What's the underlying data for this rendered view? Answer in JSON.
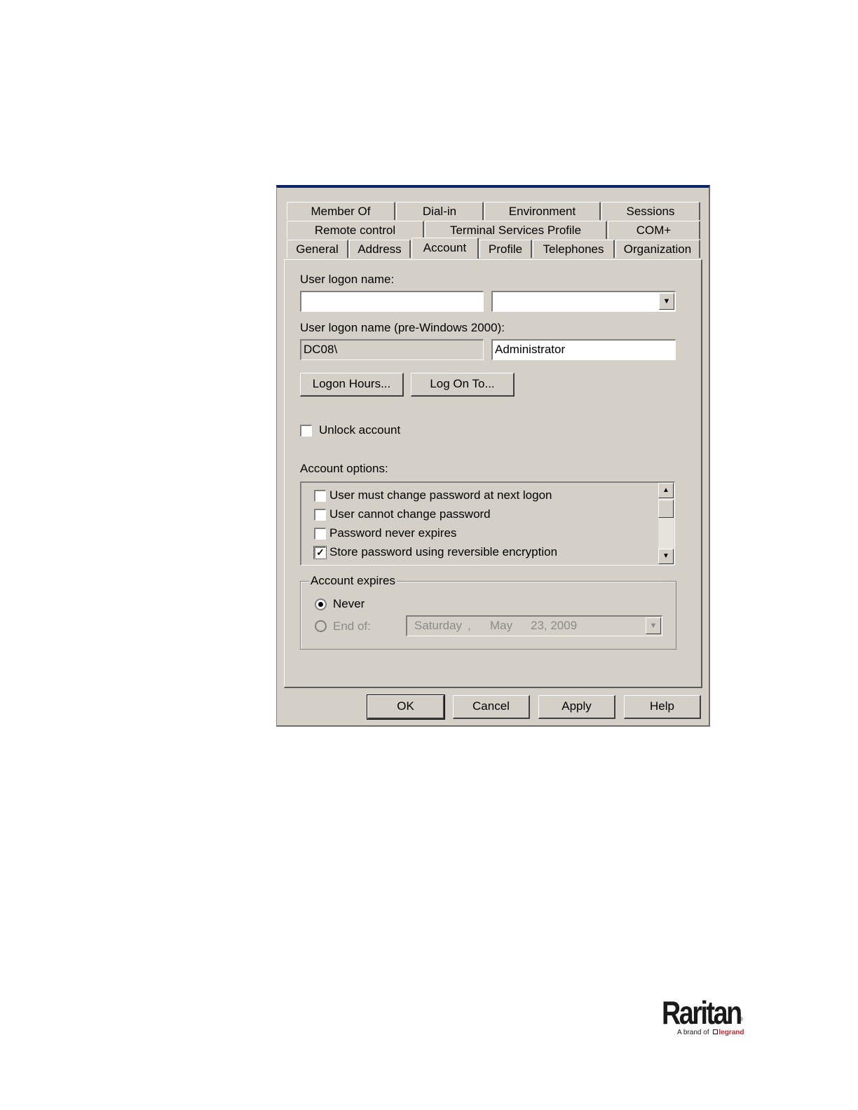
{
  "tabs": {
    "row1": [
      "Member Of",
      "Dial-in",
      "Environment",
      "Sessions"
    ],
    "row2": [
      "Remote control",
      "Terminal Services Profile",
      "COM+"
    ],
    "row3": [
      "General",
      "Address",
      "Account",
      "Profile",
      "Telephones",
      "Organization"
    ],
    "active": "Account"
  },
  "account": {
    "logon_name_label": "User logon name:",
    "logon_name_value": "",
    "upn_suffix_value": "",
    "pre2000_label": "User logon name (pre-Windows 2000):",
    "domain_value": "DC08\\",
    "sam_value": "Administrator",
    "logon_hours_button": "Logon Hours...",
    "log_on_to_button": "Log On To...",
    "unlock_label": "Unlock account",
    "unlock_checked": false,
    "options_label": "Account options:",
    "options": [
      {
        "label": "User must change password at next logon",
        "checked": false
      },
      {
        "label": "User cannot change password",
        "checked": false
      },
      {
        "label": "Password never expires",
        "checked": false
      },
      {
        "label": "Store password using reversible encryption",
        "checked": true
      }
    ],
    "expires_group": "Account expires",
    "never_label": "Never",
    "never_selected": true,
    "end_of_label": "End of:",
    "end_of_selected": false,
    "end_date_day": "Saturday",
    "end_date_sep": ",",
    "end_date_month": "May",
    "end_date_rest": "23, 2009"
  },
  "buttons": {
    "ok": "OK",
    "cancel": "Cancel",
    "apply": "Apply",
    "help": "Help"
  },
  "brand": {
    "name": "Raritan",
    "registered": "®",
    "tagline_prefix": "A brand of",
    "tagline_brand": "legrand",
    "colors": {
      "brand_text": "#1a1a1a",
      "legrand_red": "#d2232a"
    }
  }
}
